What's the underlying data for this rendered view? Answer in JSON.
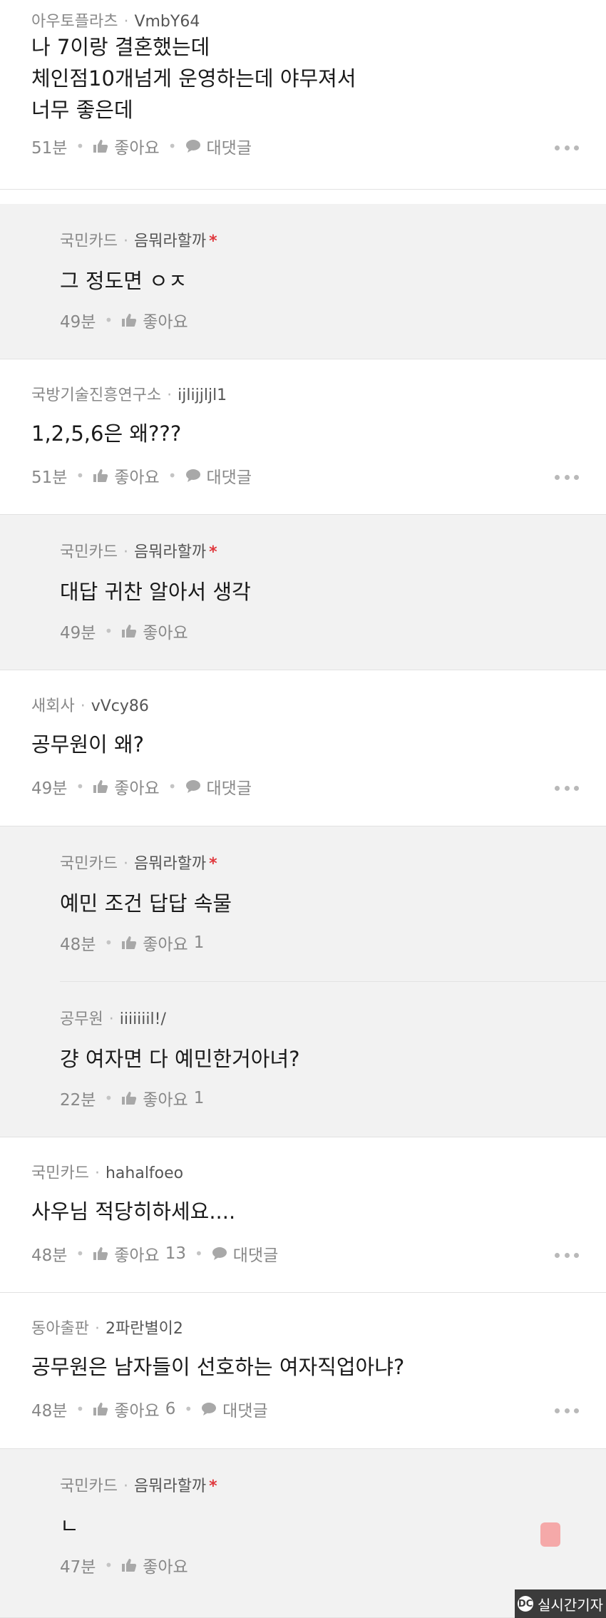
{
  "comments": [
    {
      "type": "top",
      "company": "아우토플라츠",
      "nick": "VmbY64",
      "star": false,
      "lines": [
        "나 7이랑 결혼했는데",
        "체인점10개넘게 운영하는데 야무져서",
        "너무 좋은데"
      ],
      "time": "51분",
      "like": "좋아요",
      "likes": "",
      "reply": "대댓글",
      "more": true
    },
    {
      "type": "reply",
      "company": "국민카드",
      "nick": "음뭐라할까",
      "star": true,
      "lines": [
        "그 정도면 ㅇㅈ"
      ],
      "time": "49분",
      "like": "좋아요",
      "likes": "",
      "reply": "",
      "more": false
    },
    {
      "type": "top",
      "company": "국방기술진흥연구소",
      "nick": "ijlijjljl1",
      "star": false,
      "lines": [
        "1,2,5,6은 왜???"
      ],
      "time": "51분",
      "like": "좋아요",
      "likes": "",
      "reply": "대댓글",
      "more": true
    },
    {
      "type": "reply",
      "company": "국민카드",
      "nick": "음뭐라할까",
      "star": true,
      "lines": [
        "대답 귀찬 알아서 생각"
      ],
      "time": "49분",
      "like": "좋아요",
      "likes": "",
      "reply": "",
      "more": false
    },
    {
      "type": "top",
      "company": "새회사",
      "nick": "vVcy86",
      "star": false,
      "lines": [
        "공무원이 왜?"
      ],
      "time": "49분",
      "like": "좋아요",
      "likes": "",
      "reply": "대댓글",
      "more": true
    },
    {
      "type": "reply",
      "company": "국민카드",
      "nick": "음뭐라할까",
      "star": true,
      "lines": [
        "예민 조건 답답 속물"
      ],
      "time": "48분",
      "like": "좋아요",
      "likes": "1",
      "reply": "",
      "more": false
    },
    {
      "type": "reply",
      "company": "공무원",
      "nick": "iiiiiiil!/",
      "star": false,
      "lines": [
        "걍 여자면 다 예민한거아녀?"
      ],
      "time": "22분",
      "like": "좋아요",
      "likes": "1",
      "reply": "",
      "more": false
    },
    {
      "type": "top",
      "company": "국민카드",
      "nick": "hahalfoeo",
      "star": false,
      "lines": [
        "사우님 적당히하세요...."
      ],
      "time": "48분",
      "like": "좋아요",
      "likes": "13",
      "reply": "대댓글",
      "more": true
    },
    {
      "type": "top",
      "company": "동아출판",
      "nick": "2파란별이2",
      "star": false,
      "lines": [
        "공무원은 남자들이 선호하는 여자직업아냐?"
      ],
      "time": "48분",
      "like": "좋아요",
      "likes": "6",
      "reply": "대댓글",
      "more": true
    },
    {
      "type": "reply",
      "company": "국민카드",
      "nick": "음뭐라할까",
      "star": true,
      "lines": [
        "ㄴ"
      ],
      "time": "47분",
      "like": "좋아요",
      "likes": "",
      "reply": "",
      "more": false
    }
  ],
  "watermark": {
    "logo": "DC",
    "text": "실시간기자"
  },
  "colors": {
    "reply_bg": "#f2f2f2",
    "star": "#e0393e",
    "text": "#1a1a1a",
    "meta": "#888888"
  },
  "icons": {
    "like": "thumbs-up-icon",
    "reply": "speech-bubble-icon",
    "more": "more-dots-icon"
  }
}
